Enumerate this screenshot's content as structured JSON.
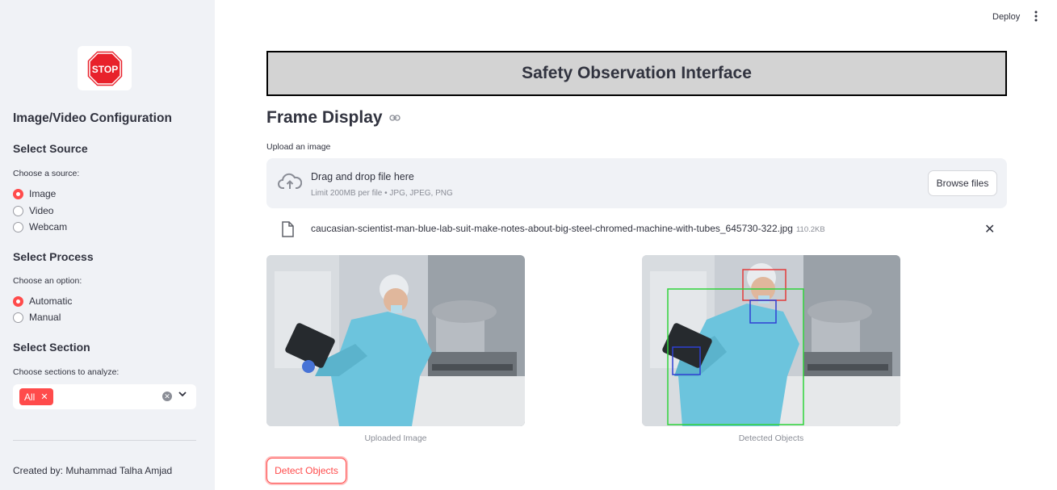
{
  "header": {
    "deploy_label": "Deploy",
    "menu_icon": "kebab-menu-icon"
  },
  "sidebar": {
    "logo_text": "STOP",
    "title": "Image/Video Configuration",
    "source": {
      "heading": "Select Source",
      "prompt": "Choose a source:",
      "options": [
        "Image",
        "Video",
        "Webcam"
      ],
      "selected": "Image"
    },
    "process": {
      "heading": "Select Process",
      "prompt": "Choose an option:",
      "options": [
        "Automatic",
        "Manual"
      ],
      "selected": "Automatic"
    },
    "section": {
      "heading": "Select Section",
      "prompt": "Choose sections to analyze:",
      "selected_chip": "All"
    },
    "footer": "Created by: Muhammad Talha Amjad"
  },
  "main": {
    "banner_title": "Safety Observation Interface",
    "frame_title": "Frame Display",
    "uploader": {
      "label": "Upload an image",
      "drag_text": "Drag and drop file here",
      "limit_text": "Limit 200MB per file • JPG, JPEG, PNG",
      "browse_label": "Browse files"
    },
    "file": {
      "name": "caucasian-scientist-man-blue-lab-suit-make-notes-about-big-steel-chromed-machine-with-tubes_645730-322.jpg",
      "size": "110.2KB"
    },
    "images": {
      "uploaded_caption": "Uploaded Image",
      "detected_caption": "Detected Objects"
    },
    "detect_button": "Detect Objects"
  },
  "colors": {
    "accent": "#ff4b4b",
    "sidebar_bg": "#f0f2f6",
    "banner_bg": "#d3d3d3"
  }
}
